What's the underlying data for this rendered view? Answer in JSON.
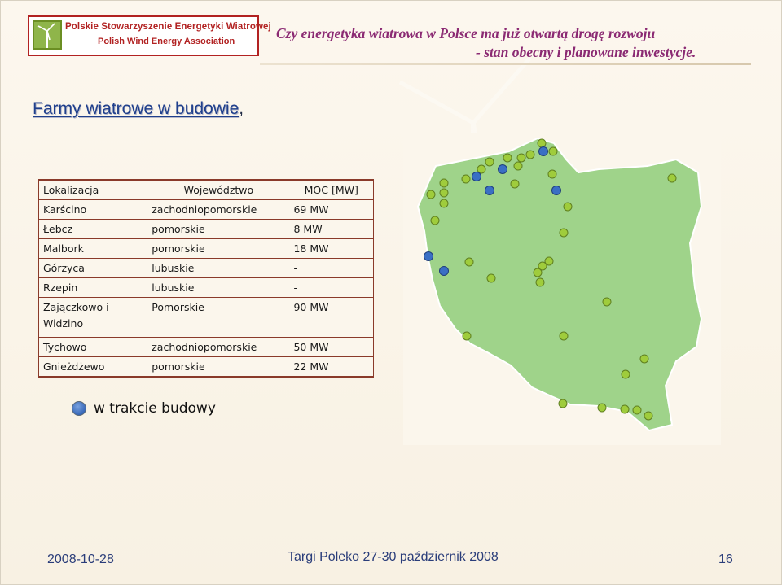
{
  "logo": {
    "line1": "Polskie Stowarzyszenie Energetyki Wiatrowej",
    "line2": "Polish Wind Energy Association",
    "emblem": "wind-turbine-emblem"
  },
  "header": {
    "title_line1": "Czy energetyka wiatrowa w Polsce ma już otwartą drogę rozwoju",
    "title_line2": "- stan obecny i planowane inwestycje."
  },
  "section": {
    "title_underlined": "Farmy wiatrowe w budowie",
    "title_suffix": ","
  },
  "table": {
    "columns": [
      "Lokalizacja",
      "Województwo",
      "MOC [MW]"
    ],
    "rows": [
      {
        "location": "Karścino",
        "voivodeship": "zachodniopomorskie",
        "power": "69 MW"
      },
      {
        "location": "Łebcz",
        "voivodeship": "pomorskie",
        "power": "8 MW"
      },
      {
        "location": "Malbork",
        "voivodeship": "pomorskie",
        "power": "18 MW"
      },
      {
        "location": "Górzyca",
        "voivodeship": "lubuskie",
        "power": "-"
      },
      {
        "location": "Rzepin",
        "voivodeship": "lubuskie",
        "power": "-"
      },
      {
        "location": "Zajączkowo i Widzino",
        "voivodeship": "Pomorskie",
        "power": "90 MW"
      },
      {
        "location": "Tychowo",
        "voivodeship": "zachodniopomorskie",
        "power": "50 MW"
      },
      {
        "location": "Gnieżdżewo",
        "voivodeship": "pomorskie",
        "power": "22 MW"
      }
    ]
  },
  "map": {
    "land_color": "#9fd38a",
    "border_color": "#ffffff",
    "existing_color": "#9fcc3c",
    "under_construction_color": "#3a6fc4"
  },
  "legend": {
    "label": "w trakcie budowy",
    "color": "#3a6fc4"
  },
  "footer": {
    "date": "2008-10-28",
    "event": "Targi Poleko 27-30 październik 2008",
    "page": "16"
  }
}
